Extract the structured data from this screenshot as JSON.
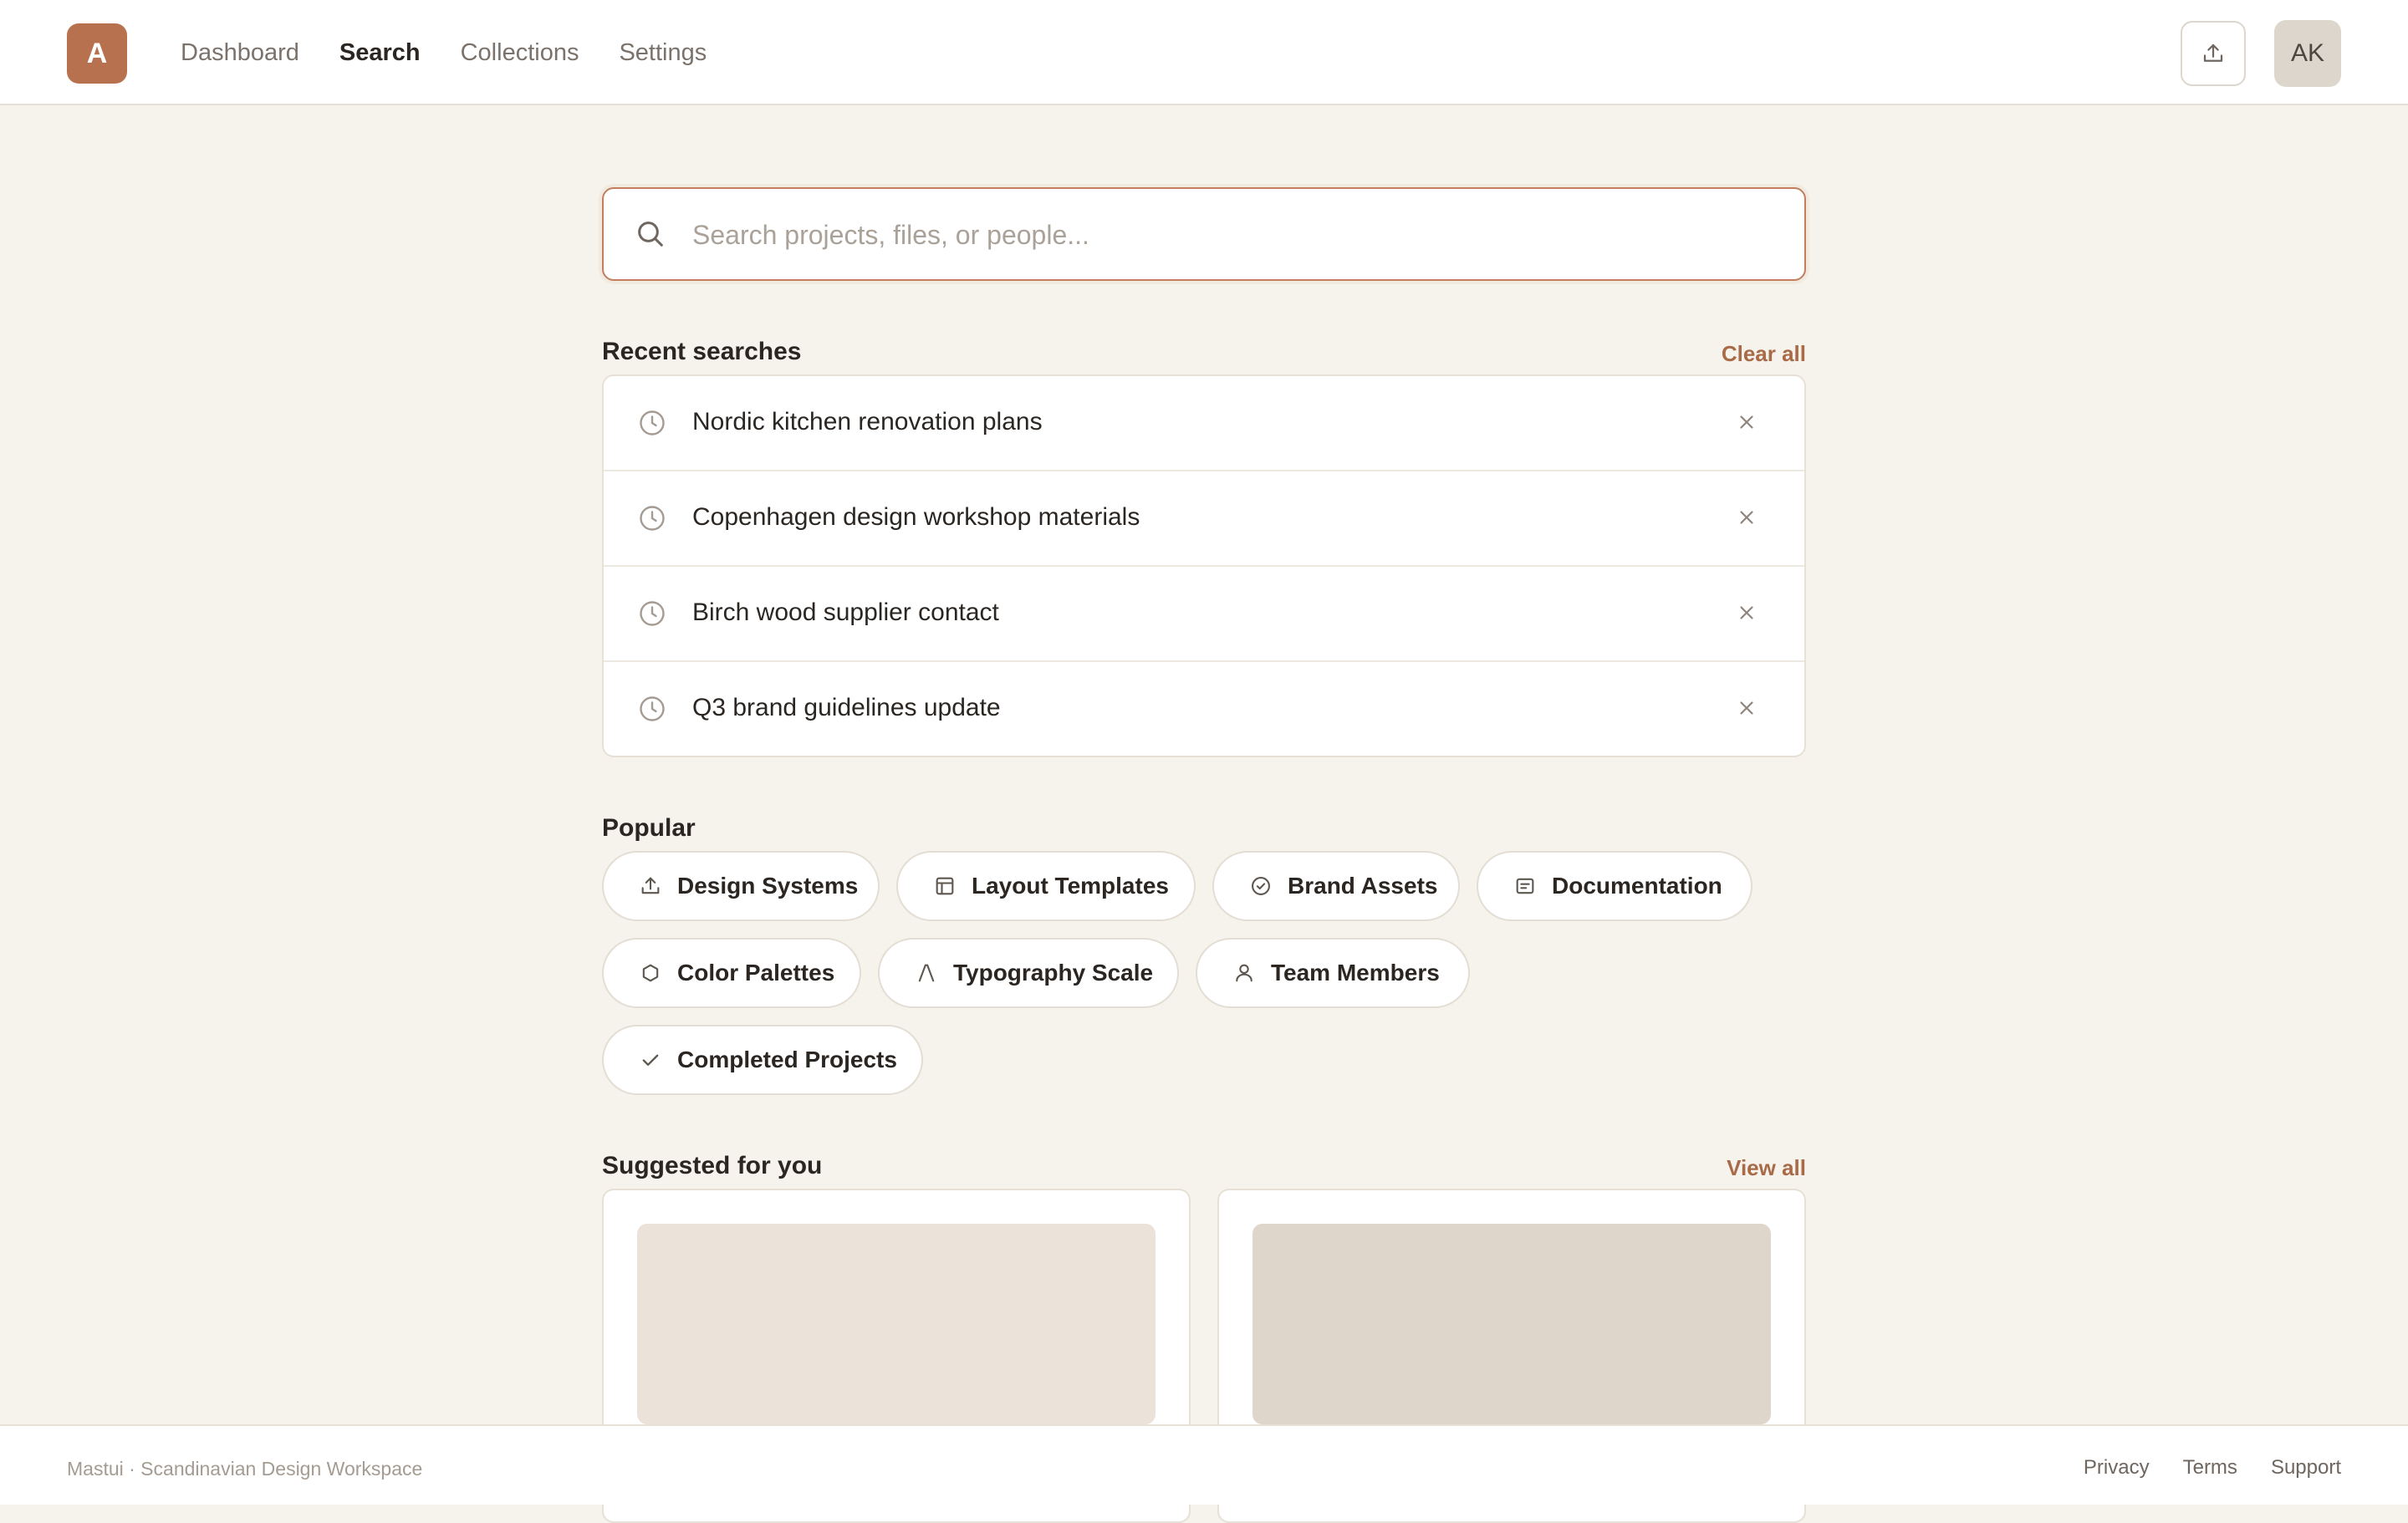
{
  "header": {
    "logo_letter": "A",
    "nav": [
      {
        "label": "Dashboard",
        "active": false
      },
      {
        "label": "Search",
        "active": true
      },
      {
        "label": "Collections",
        "active": false
      },
      {
        "label": "Settings",
        "active": false
      }
    ],
    "avatar_initials": "AK",
    "upload_icon": "upload-icon"
  },
  "search": {
    "placeholder": "Search projects, files, or people...",
    "value": ""
  },
  "recent": {
    "title": "Recent searches",
    "clear_label": "Clear all",
    "items": [
      "Nordic kitchen renovation plans",
      "Copenhagen design workshop materials",
      "Birch wood supplier contact",
      "Q3 brand guidelines update"
    ]
  },
  "popular": {
    "title": "Popular",
    "chips": [
      {
        "label": "Design Systems",
        "icon": "upload-icon"
      },
      {
        "label": "Layout Templates",
        "icon": "layout-icon"
      },
      {
        "label": "Brand Assets",
        "icon": "check-circle-icon"
      },
      {
        "label": "Documentation",
        "icon": "document-icon"
      },
      {
        "label": "Color Palettes",
        "icon": "hexagon-icon"
      },
      {
        "label": "Typography Scale",
        "icon": "typography-icon"
      },
      {
        "label": "Team Members",
        "icon": "user-icon"
      },
      {
        "label": "Completed Projects",
        "icon": "check-icon"
      }
    ]
  },
  "suggested": {
    "title": "Suggested for you",
    "view_all_label": "View all"
  },
  "footer": {
    "brand": "Mastui · Scandinavian Design Workspace",
    "links": [
      "Privacy",
      "Terms",
      "Support"
    ]
  },
  "colors": {
    "accent": "#b8714f",
    "background": "#f6f3ed",
    "link": "#a86a47"
  }
}
